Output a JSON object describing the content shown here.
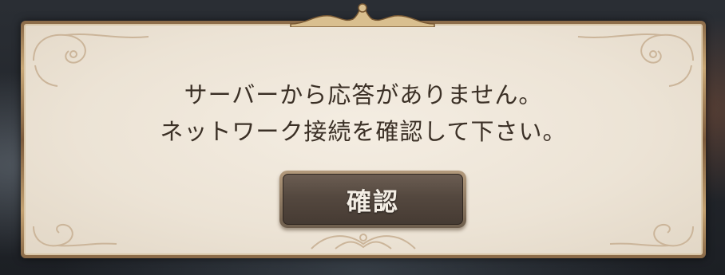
{
  "dialog": {
    "message_lines": [
      "サーバーから応答がありません。",
      "ネットワーク接続を確認して下さい。"
    ],
    "confirm_label": "確認"
  },
  "colors": {
    "panel": "#ece3d5",
    "frame_gold": "#c9a877",
    "text": "#3b3026",
    "button": "#54483f",
    "button_text": "#f3ede4"
  },
  "icons": [
    "top-crest-ornament",
    "corner-filigree",
    "bottom-filigree"
  ]
}
